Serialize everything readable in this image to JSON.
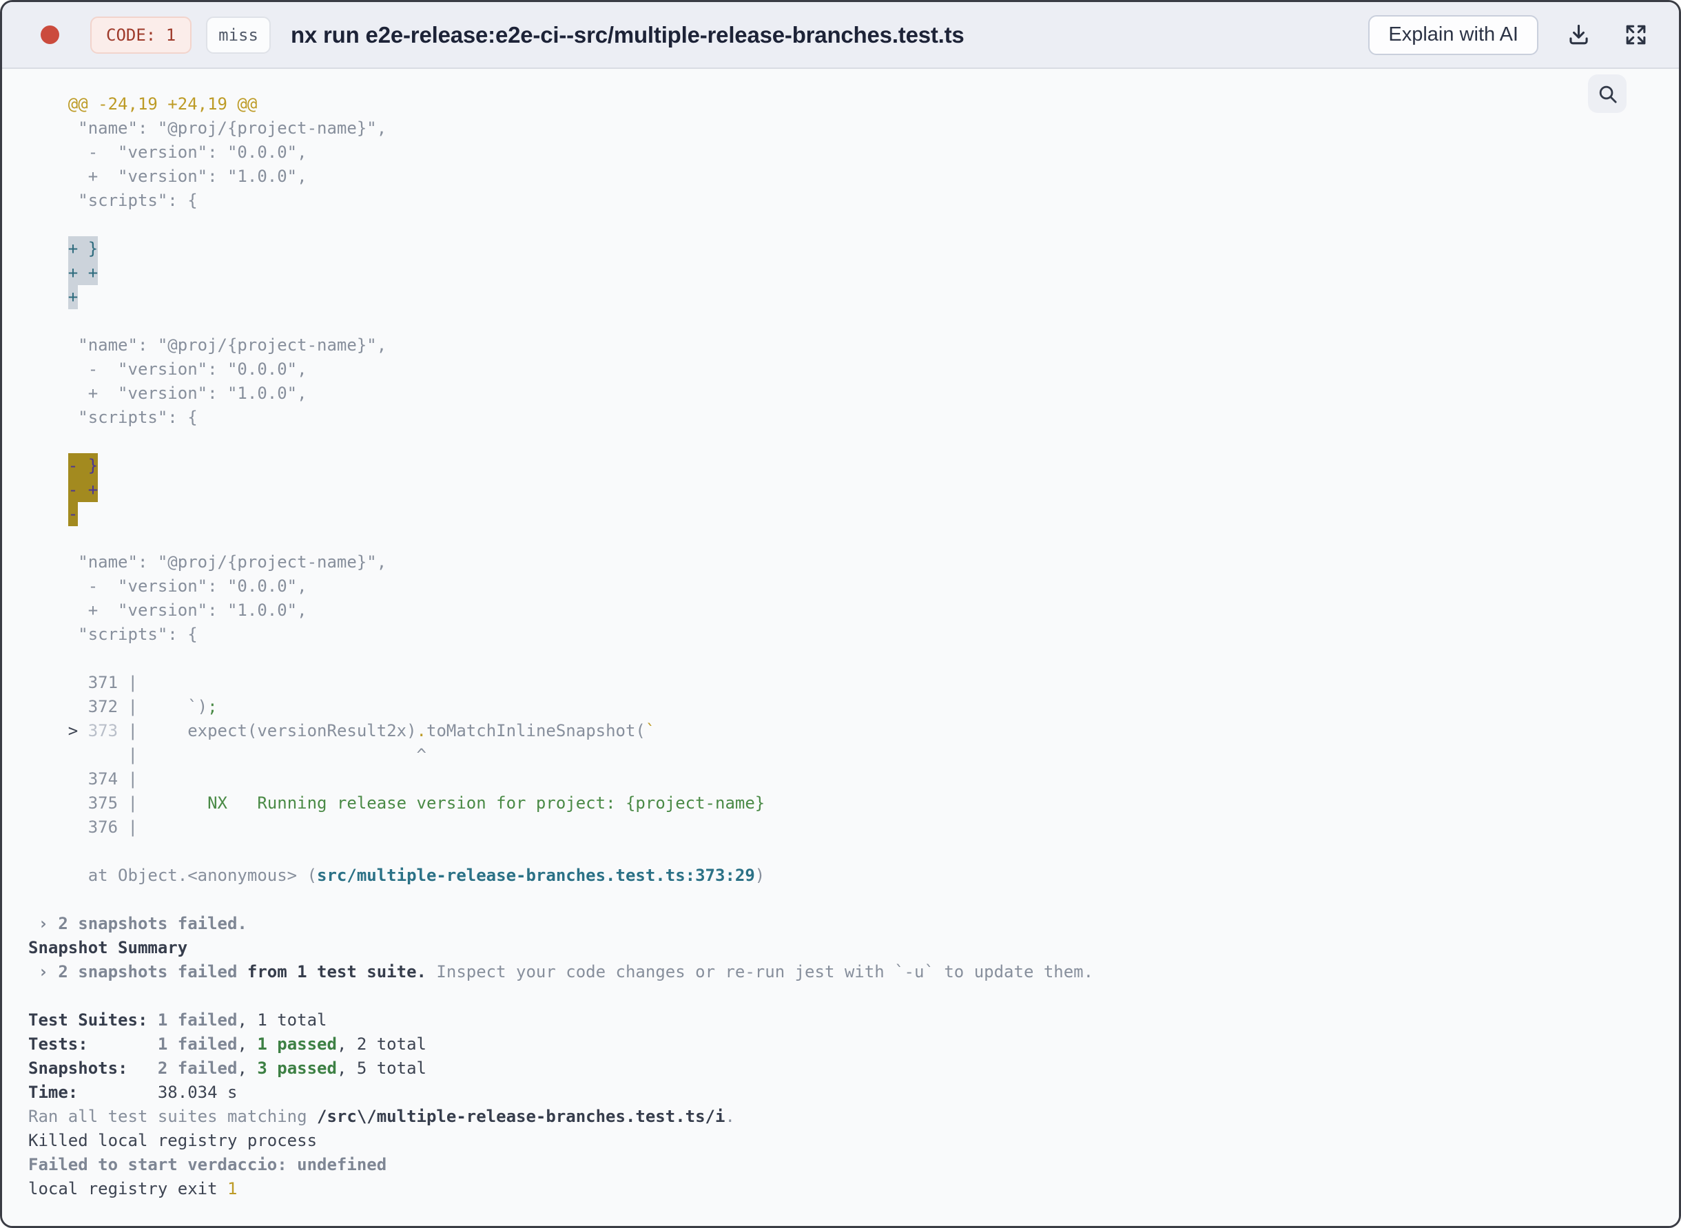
{
  "header": {
    "exit_code_label": "CODE: 1",
    "cache_status_label": "miss",
    "title": "nx run e2e-release:e2e-ci--src/multiple-release-branches.test.ts",
    "explain_button_label": "Explain with AI",
    "icons": {
      "status": "status-dot-icon",
      "download": "download-icon",
      "expand": "expand-icon",
      "search": "search-icon"
    },
    "colors": {
      "status_dot": "#cb4b3d",
      "exit_code_text": "#9e3a2a",
      "header_bg": "#eceef4"
    }
  },
  "terminal": {
    "colors": {
      "diff_header_yellow": "#bd9b26",
      "passed_green": "#3d8044",
      "file_link_teal": "#2b7186",
      "added_highlight_bg": "#ccd3db",
      "added_highlight_text": "#2e6b7d",
      "removed_highlight_bg": "#a38a1f",
      "removed_highlight_text": "#4b3695"
    },
    "lines": [
      [
        {
          "t": "    @@ -24,19 +24,19 @@",
          "s": "yellow"
        }
      ],
      [
        {
          "t": "     \"name\": \"@proj/{project-name}\",",
          "s": "gray"
        }
      ],
      [
        {
          "t": "      -  \"version\": \"0.0.0\",",
          "s": "gray"
        }
      ],
      [
        {
          "t": "      +  \"version\": \"1.0.0\",",
          "s": "gray"
        }
      ],
      [
        {
          "t": "     \"scripts\": {",
          "s": "gray"
        }
      ],
      [],
      [
        {
          "t": "    ",
          "s": "gray"
        },
        {
          "t": "+ }",
          "s": "hl-add"
        }
      ],
      [
        {
          "t": "    ",
          "s": "gray"
        },
        {
          "t": "+ +",
          "s": "hl-add"
        }
      ],
      [
        {
          "t": "    ",
          "s": "gray"
        },
        {
          "t": "+",
          "s": "hl-add"
        }
      ],
      [],
      [
        {
          "t": "     \"name\": \"@proj/{project-name}\",",
          "s": "gray"
        }
      ],
      [
        {
          "t": "      -  \"version\": \"0.0.0\",",
          "s": "gray"
        }
      ],
      [
        {
          "t": "      +  \"version\": \"1.0.0\",",
          "s": "gray"
        }
      ],
      [
        {
          "t": "     \"scripts\": {",
          "s": "gray"
        }
      ],
      [],
      [
        {
          "t": "    ",
          "s": "gray"
        },
        {
          "t": "- }",
          "s": "hl-del"
        }
      ],
      [
        {
          "t": "    ",
          "s": "gray"
        },
        {
          "t": "- +",
          "s": "hl-del"
        }
      ],
      [
        {
          "t": "    ",
          "s": "gray"
        },
        {
          "t": "-",
          "s": "hl-del"
        }
      ],
      [],
      [
        {
          "t": "     \"name\": \"@proj/{project-name}\",",
          "s": "gray"
        }
      ],
      [
        {
          "t": "      -  \"version\": \"0.0.0\",",
          "s": "gray"
        }
      ],
      [
        {
          "t": "      +  \"version\": \"1.0.0\",",
          "s": "gray"
        }
      ],
      [
        {
          "t": "     \"scripts\": {",
          "s": "gray"
        }
      ],
      [],
      [
        {
          "t": "      371 |",
          "s": "gray"
        }
      ],
      [
        {
          "t": "      372 |     `)",
          "s": "gray"
        },
        {
          "t": ";",
          "s": "green"
        }
      ],
      [
        {
          "t": "    ",
          "s": "gray"
        },
        {
          "t": ">",
          "s": "dark"
        },
        {
          "t": " ",
          "s": "gray"
        },
        {
          "t": "373",
          "s": "dim"
        },
        {
          "t": " |     expect(versionResult2x)",
          "s": "gray"
        },
        {
          "t": ".",
          "s": "yellow"
        },
        {
          "t": "toMatchInlineSnapshot(",
          "s": "gray"
        },
        {
          "t": "`",
          "s": "yellow"
        }
      ],
      [
        {
          "t": "          |                            ^",
          "s": "gray"
        }
      ],
      [
        {
          "t": "      374 |",
          "s": "gray"
        }
      ],
      [
        {
          "t": "      375 |",
          "s": "gray"
        },
        {
          "t": "       NX   Running release version for project: {project-name}",
          "s": "green"
        }
      ],
      [
        {
          "t": "      376 |",
          "s": "gray"
        }
      ],
      [],
      [
        {
          "t": "      at Object.<anonymous> (",
          "s": "gray"
        },
        {
          "t": "src/multiple-release-branches.test.ts:373:29",
          "s": "teal-bold"
        },
        {
          "t": ")",
          "s": "gray"
        }
      ],
      [],
      [
        {
          "t": " › 2 snapshots failed.",
          "s": "gray-bold"
        }
      ],
      [
        {
          "t": "Snapshot Summary",
          "s": "dark-bold"
        }
      ],
      [
        {
          "t": " › 2 snapshots failed",
          "s": "gray-bold"
        },
        {
          "t": " from 1 test suite.",
          "s": "dark-bold"
        },
        {
          "t": " Inspect your code changes or re-run jest with `-u` to update them.",
          "s": "gray"
        }
      ],
      [],
      [
        {
          "t": "Test Suites: ",
          "s": "dark-bold"
        },
        {
          "t": "1 failed",
          "s": "gray-bold"
        },
        {
          "t": ", 1 total",
          "s": "dark"
        }
      ],
      [
        {
          "t": "Tests:       ",
          "s": "dark-bold"
        },
        {
          "t": "1 failed",
          "s": "gray-bold"
        },
        {
          "t": ", ",
          "s": "dark"
        },
        {
          "t": "1 passed",
          "s": "green-bold"
        },
        {
          "t": ", 2 total",
          "s": "dark"
        }
      ],
      [
        {
          "t": "Snapshots:   ",
          "s": "dark-bold"
        },
        {
          "t": "2 failed",
          "s": "gray-bold"
        },
        {
          "t": ", ",
          "s": "dark"
        },
        {
          "t": "3 passed",
          "s": "green-bold"
        },
        {
          "t": ", 5 total",
          "s": "dark"
        }
      ],
      [
        {
          "t": "Time:        ",
          "s": "dark-bold"
        },
        {
          "t": "38.034 s",
          "s": "dark"
        }
      ],
      [
        {
          "t": "Ran all test suites matching ",
          "s": "gray"
        },
        {
          "t": "/src\\/multiple-release-branches.test.ts/i",
          "s": "dark-bold"
        },
        {
          "t": ".",
          "s": "gray"
        }
      ],
      [
        {
          "t": "Killed local registry process",
          "s": "dark"
        }
      ],
      [
        {
          "t": "Failed to start verdaccio: undefined",
          "s": "gray-bold"
        }
      ],
      [
        {
          "t": "local registry exit ",
          "s": "dark"
        },
        {
          "t": "1",
          "s": "yellow"
        }
      ]
    ]
  }
}
